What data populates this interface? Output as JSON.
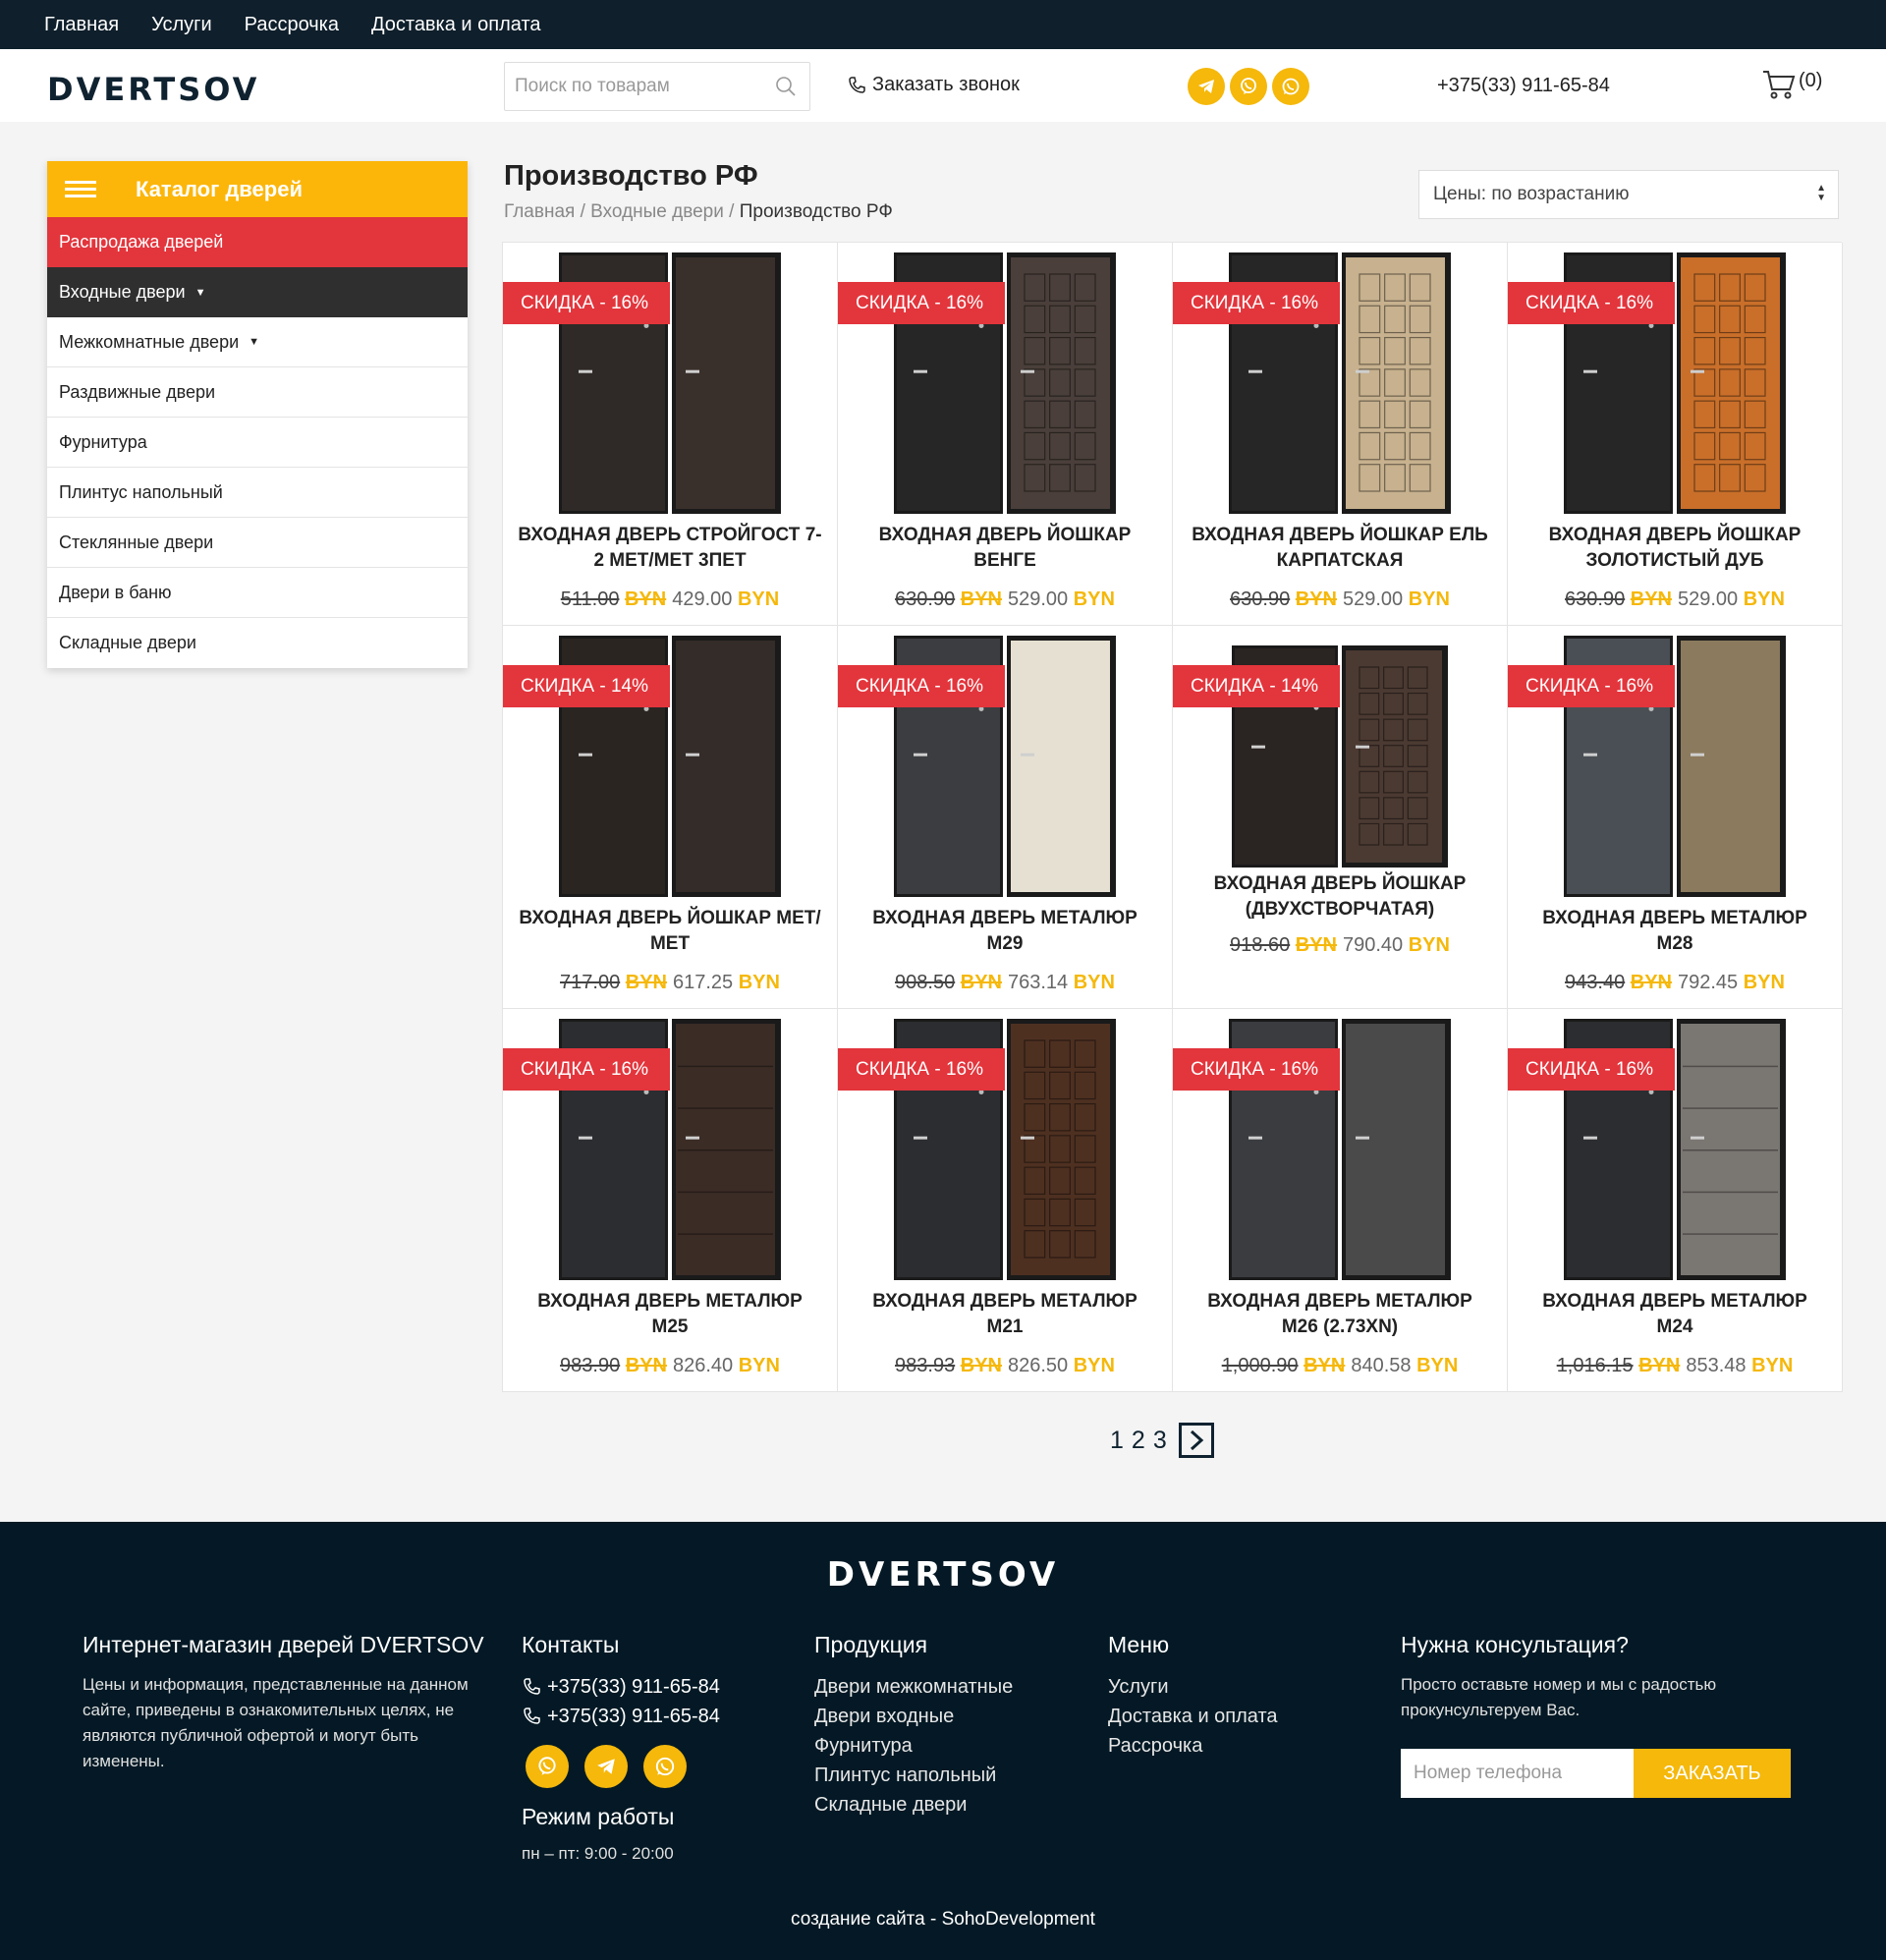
{
  "topnav": [
    "Главная",
    "Услуги",
    "Рассрочка",
    "Доставка и оплата"
  ],
  "header": {
    "logo": "DVERTSOV",
    "search_placeholder": "Поиск по товарам",
    "callback": "Заказать звонок",
    "phone": "+375(33) 911-65-84",
    "cart_count": "(0)"
  },
  "sidebar": {
    "title": "Каталог дверей",
    "items": [
      {
        "label": "Распродажа дверей",
        "style": "sale"
      },
      {
        "label": "Входные двери",
        "style": "active",
        "caret": "▼"
      },
      {
        "label": "Межкомнатные двери",
        "style": "normal",
        "caret": "▼"
      },
      {
        "label": "Раздвижные двери",
        "style": "normal"
      },
      {
        "label": "Фурнитура",
        "style": "normal"
      },
      {
        "label": "Плинтус напольный",
        "style": "normal"
      },
      {
        "label": "Стеклянные двери",
        "style": "normal"
      },
      {
        "label": "Двери в баню",
        "style": "normal"
      },
      {
        "label": "Складные двери",
        "style": "normal"
      }
    ]
  },
  "main": {
    "title": "Производство РФ",
    "breadcrumb": {
      "home": "Главная",
      "sep": " / ",
      "parent": "Входные двери",
      "current": "Производство РФ"
    },
    "sort_label": "Цены: по возрастанию"
  },
  "products": [
    {
      "badge": "СКИДКА -  16%",
      "name": "Входная дверь Стройгост 7-2 Мет/Мет 3пет",
      "old": "511.00",
      "new": "429.00",
      "cur": "BYN",
      "left": "#2f2a27",
      "right": "#3a302b",
      "panel": "plain"
    },
    {
      "badge": "СКИДКА -  16%",
      "name": "Входная дверь Йошкар Венге",
      "old": "630.90",
      "new": "529.00",
      "cur": "BYN",
      "left": "#262626",
      "right": "#4a3f3a",
      "panel": "grid"
    },
    {
      "badge": "СКИДКА -  16%",
      "name": "Входная дверь Йошкар Ель карпатская",
      "old": "630.90",
      "new": "529.00",
      "cur": "BYN",
      "left": "#262626",
      "right": "#c7b18e",
      "panel": "grid"
    },
    {
      "badge": "СКИДКА -  16%",
      "name": "Входная дверь Йошкар Золотистый дуб",
      "old": "630.90",
      "new": "529.00",
      "cur": "BYN",
      "left": "#262626",
      "right": "#c96f2a",
      "panel": "grid"
    },
    {
      "badge": "СКИДКА -  14%",
      "name": "Входная дверь Йошкар Мет/Мет",
      "old": "717.00",
      "new": "617.25",
      "cur": "BYN",
      "left": "#2b2522",
      "right": "#342c28",
      "panel": "plain"
    },
    {
      "badge": "СКИДКА -  16%",
      "name": "Входная дверь Металюр М29",
      "old": "908.50",
      "new": "763.14",
      "cur": "BYN",
      "left": "#3b3d40",
      "right": "#e6e0d2",
      "panel": "plain"
    },
    {
      "badge": "СКИДКА -  14%",
      "name": "Входная дверь Йошкар (двухстворчатая)",
      "old": "918.60",
      "new": "790.40",
      "cur": "BYN",
      "left": "#2a2422",
      "right": "#4b3a32",
      "panel": "grid",
      "wide": true
    },
    {
      "badge": "СКИДКА -  16%",
      "name": "Входная дверь Металюр М28",
      "old": "943.40",
      "new": "792.45",
      "cur": "BYN",
      "left": "#4a4f55",
      "right": "#8c7a5e",
      "panel": "plain"
    },
    {
      "badge": "СКИДКА -  16%",
      "name": "Входная дверь Металюр М25",
      "old": "983.90",
      "new": "826.40",
      "cur": "BYN",
      "left": "#2b2d30",
      "right": "#3b2c26",
      "panel": "lines"
    },
    {
      "badge": "СКИДКА -  16%",
      "name": "Входная дверь Металюр М21",
      "old": "983.93",
      "new": "826.50",
      "cur": "BYN",
      "left": "#2b2d30",
      "right": "#4e3021",
      "panel": "grid"
    },
    {
      "badge": "СКИДКА -  16%",
      "name": "Входная дверь Металюр М26 (2.73XN)",
      "old": "1,000.90",
      "new": "840.58",
      "cur": "BYN",
      "left": "#3a3c40",
      "right": "#4a4a4a",
      "panel": "plain"
    },
    {
      "badge": "СКИДКА -  16%",
      "name": "Входная дверь Металюр М24",
      "old": "1,016.15",
      "new": "853.48",
      "cur": "BYN",
      "left": "#2b2d30",
      "right": "#7a7672",
      "panel": "lines"
    }
  ],
  "pagination": {
    "pages": [
      "1",
      "2",
      "3"
    ]
  },
  "footer": {
    "logo": "DVERTSOV",
    "about_title": "Интернет-магазин дверей DVERTSOV",
    "about_text": "Цены и информация, представленные на данном сайте, приведены в ознакомительных целях, не являются публичной офертой и могут быть изменены.",
    "contacts_title": "Контакты",
    "phones": [
      "+375(33) 911-65-84",
      "+375(33) 911-65-84"
    ],
    "hours_title": "Режим работы",
    "hours": "пн – пт: 9:00 - 20:00",
    "products_title": "Продукция",
    "products_links": [
      "Двери межкомнатные",
      "Двери входные",
      "Фурнитура",
      "Плинтус напольный",
      "Складные двери"
    ],
    "menu_title": "Меню",
    "menu_links": [
      "Услуги",
      "Доставка и оплата",
      "Рассрочка"
    ],
    "consult_title": "Нужна консультация?",
    "consult_text": "Просто оставьте номер и мы с радостью прокунсультеруем Вас.",
    "phone_placeholder": "Номер телефона",
    "order_button": "Заказать",
    "credits": "создание сайта - SohoDevelopment"
  },
  "colors": {
    "accent": "#f5b80b",
    "sale": "#e3353c",
    "dark": "#041925"
  }
}
